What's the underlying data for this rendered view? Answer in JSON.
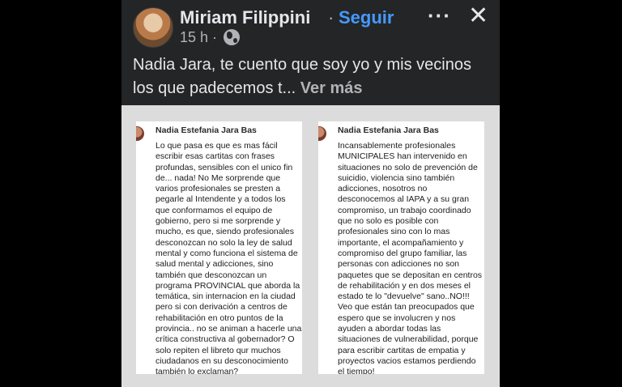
{
  "post": {
    "author": "Miriam Filippini",
    "separator": "·",
    "follow_label": "Seguir",
    "time": "15 h",
    "meta_separator": "·",
    "privacy_icon": "globe-icon",
    "more_icon": "more-options-icon",
    "more_glyph": "···",
    "close_icon": "close-icon",
    "close_glyph": "✕",
    "text": "Nadia Jara, te cuento que soy yo y mis vecinos los  que padecemos t...",
    "see_more_label": "Ver más"
  },
  "screenshots": [
    {
      "name": "Nadia Estefania Jara Bas",
      "lines": [
        "Lo que pasa es que es mas fácil",
        "escribir esas cartitas con frases",
        "profundas, sensibles con el unico fin",
        "de... nada! No Me sorprende que",
        "varios profesionales se presten a",
        "pegarle al Intendente y a todos los",
        "que conformamos el equipo de",
        "gobierno, pero si me sorprende y",
        "mucho, es que, siendo profesionales",
        "desconozcan no solo la ley de salud",
        "mental y como funciona el sistema de",
        "salud mental y adicciones, sino",
        "también que desconozcan un",
        "programa PROVINCIAL que aborda la",
        "temática, sin internacion en la ciudad",
        "pero si con derivación a centros de",
        "rehabilitación en otro puntos de la",
        "provincia.. no se animan a hacerle una",
        "crítica constructiva al gobernador? O",
        "solo repiten el libreto qur muchos",
        "ciudadanos en su desconocimiento",
        "también lo exclaman?"
      ]
    },
    {
      "name": "Nadia Estefania Jara Bas",
      "lines": [
        "Incansablemente profesionales",
        "MUNICIPALES han intervenido en",
        "situaciones no solo de prevención de",
        "suicidio, violencia sino también",
        "adicciones, nosotros no",
        "desconocemos al IAPA y a su gran",
        "compromiso, un trabajo coordinado",
        "que no solo es posible con",
        "profesionales sino con lo mas",
        "importante, el acompañamiento y",
        "compromiso del grupo familiar, las",
        "personas con adicciones no son",
        "paquetes que se depositan en centros",
        "de rehabilitación y en dos meses el",
        "estado te lo \"devuelve\" sano..NO!!!",
        "Veo que están tan preocupados que",
        "espero que se involucren y nos",
        "ayuden a abordar todas las",
        "situaciones de vulnerabilidad, porque",
        "para escribir cartitas de empatia y",
        "proyectos vacios estamos perdiendo",
        "el tiempo!"
      ]
    }
  ]
}
